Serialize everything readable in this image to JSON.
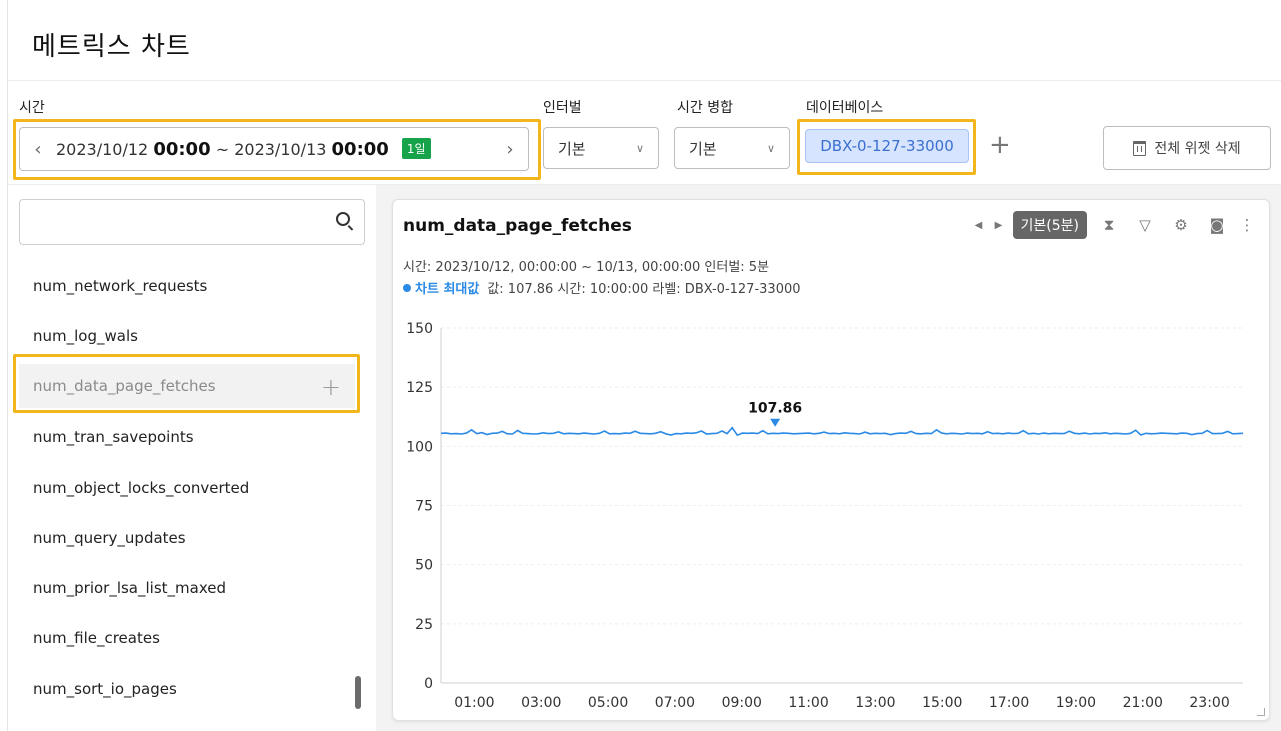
{
  "page": {
    "title": "메트릭스 차트"
  },
  "toolbar": {
    "time_label": "시간",
    "time_start_date": "2023/10/12",
    "time_start_hm": "00:00",
    "time_sep": "~",
    "time_end_date": "2023/10/13",
    "time_end_hm": "00:00",
    "time_badge": "1일",
    "interval_label": "인터벌",
    "interval_value": "기본",
    "merge_label": "시간 병합",
    "merge_value": "기본",
    "db_label": "데이터베이스",
    "db_chip": "DBX-0-127-33000",
    "delete_all": "전체 위젯 삭제"
  },
  "sidebar": {
    "search_placeholder": "",
    "items": [
      {
        "label": "num_network_requests"
      },
      {
        "label": "num_log_wals"
      },
      {
        "label": "num_data_page_fetches"
      },
      {
        "label": "num_tran_savepoints"
      },
      {
        "label": "num_object_locks_converted"
      },
      {
        "label": "num_query_updates"
      },
      {
        "label": "num_prior_lsa_list_maxed"
      },
      {
        "label": "num_file_creates"
      },
      {
        "label": "num_sort_io_pages"
      }
    ]
  },
  "widget": {
    "title": "num_data_page_fetches",
    "agg_badge": "기본(5분)",
    "meta": "시간: 2023/10/12, 00:00:00 ~ 10/13, 00:00:00   인터벌: 5분",
    "max_label": "차트 최대값",
    "max_info": "값: 107.86   시간: 10:00:00   라벨: DBX-0-127-33000",
    "max_value_label": "107.86"
  },
  "colors": {
    "accent": "#2a8ae6",
    "highlight": "#f2b61c",
    "badge_green": "#16a34a"
  },
  "chart_data": {
    "type": "line",
    "x_ticks": [
      "01:00",
      "03:00",
      "05:00",
      "07:00",
      "09:00",
      "11:00",
      "13:00",
      "15:00",
      "17:00",
      "19:00",
      "21:00",
      "23:00"
    ],
    "y_ticks": [
      0,
      25,
      50,
      75,
      100,
      125,
      150
    ],
    "ylim": [
      0,
      150
    ],
    "x_range_hours": [
      0,
      24
    ],
    "series": [
      {
        "values": [
          105.5,
          105.6,
          105.3,
          105.4,
          105.2,
          105.6,
          107.0,
          105.4,
          105.8,
          105.0,
          105.5,
          105.6,
          106.3,
          105.3,
          105.2,
          106.7,
          105.5,
          105.4,
          105.2,
          105.3,
          105.7,
          105.4,
          105.5,
          106.1,
          105.3,
          105.5,
          105.4,
          105.3,
          105.6,
          105.4,
          105.2,
          105.5,
          106.5,
          105.3,
          105.4,
          105.3,
          105.6,
          105.5,
          106.4,
          105.5,
          105.4,
          105.3,
          105.5,
          106.2,
          105.3,
          104.8,
          105.4,
          105.3,
          105.6,
          105.5,
          105.7,
          106.5,
          105.2,
          105.4,
          105.5,
          106.5,
          105.4,
          107.86,
          104.7,
          105.6,
          105.5,
          105.6,
          105.4,
          106.6,
          105.3,
          105.5,
          105.4,
          105.6,
          105.5,
          105.3,
          105.4,
          105.5,
          105.6,
          105.3,
          105.5,
          106.0,
          105.4,
          105.5,
          105.3,
          105.7,
          105.5,
          105.4,
          105.2,
          106.0,
          105.3,
          105.5,
          105.4,
          105.5,
          104.9,
          105.4,
          105.6,
          105.5,
          106.3,
          105.4,
          105.3,
          105.5,
          105.4,
          107.0,
          105.6,
          105.3,
          105.5,
          105.4,
          105.2,
          105.6,
          105.4,
          105.5,
          105.3,
          106.2,
          105.4,
          105.5,
          105.3,
          105.6,
          105.4,
          105.5,
          106.6,
          105.3,
          105.5,
          105.2,
          105.6,
          105.3,
          105.5,
          105.4,
          105.4,
          106.4,
          105.5,
          105.3,
          105.6,
          105.2,
          105.5,
          105.4,
          105.7,
          105.3,
          105.5,
          105.4,
          105.2,
          105.5,
          106.8,
          104.8,
          105.5,
          105.3,
          105.4,
          105.6,
          105.5,
          105.4,
          105.3,
          105.6,
          105.5,
          104.9,
          105.4,
          105.5,
          106.7,
          105.4,
          105.4,
          105.5,
          106.3,
          105.3,
          105.4,
          105.5
        ]
      }
    ],
    "max_point": {
      "value": 107.86,
      "time": "10:00:00"
    }
  }
}
